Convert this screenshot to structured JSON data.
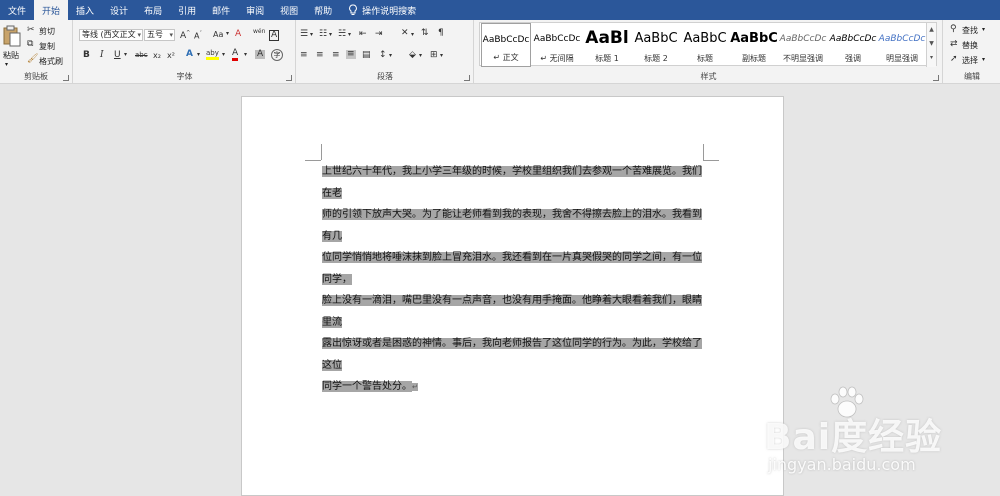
{
  "tabs": [
    "文件",
    "开始",
    "插入",
    "设计",
    "布局",
    "引用",
    "邮件",
    "审阅",
    "视图",
    "帮助",
    "操作说明搜索"
  ],
  "active_tab": "开始",
  "clipboard": {
    "paste": "粘贴",
    "cut": "剪切",
    "copy": "复制",
    "format_painter": "格式刷",
    "group_label": "剪贴板"
  },
  "font": {
    "font_name": "等线 (西文正文",
    "font_size": "五号",
    "group_label": "字体",
    "change_case": "Aa",
    "phonetic": "wén",
    "char_border": "A",
    "bold": "B",
    "italic": "I",
    "underline": "U",
    "strike": "abc",
    "subscript": "x₂",
    "superscript": "x²",
    "highlight": "aby",
    "font_color": "A",
    "char_shading": "A",
    "enclose": "字"
  },
  "paragraph": {
    "group_label": "段落"
  },
  "styles": {
    "group_label": "样式",
    "items": [
      {
        "sample": "AaBbCcDc",
        "name": "↵ 正文"
      },
      {
        "sample": "AaBbCcDc",
        "name": "↵ 无间隔"
      },
      {
        "sample": "AaBl",
        "name": "标题 1"
      },
      {
        "sample": "AaBbC",
        "name": "标题 2"
      },
      {
        "sample": "AaBbC",
        "name": "标题"
      },
      {
        "sample": "AaBbC",
        "name": "副标题"
      },
      {
        "sample": "AaBbCcDc",
        "name": "不明显强调"
      },
      {
        "sample": "AaBbCcDc",
        "name": "强调"
      },
      {
        "sample": "AaBbCcDc",
        "name": "明显强调"
      }
    ]
  },
  "editing": {
    "find": "查找",
    "replace": "替换",
    "select": "选择",
    "group_label": "编辑"
  },
  "document": {
    "lines": [
      "上世纪六十年代，我上小学三年级的时候，学校里组织我们去参观一个苦难展览。我们在老",
      "师的引领下放声大哭。为了能让老师看到我的表现，我舍不得擦去脸上的泪水。我看到有几",
      "位同学悄悄地将唾沫抹到脸上冒充泪水。我还看到在一片真哭假哭的同学之间，有一位同学，",
      "脸上没有一滴泪，嘴巴里没有一点声音，也没有用手掩面。他睁着大眼看着我们，眼睛里流",
      "露出惊讶或者是困惑的神情。事后，我向老师报告了这位同学的行为。为此，学校给了这位",
      "同学一个警告处分。"
    ],
    "paragraph_mark": "↵"
  },
  "watermark": {
    "brand": "Bai度经验",
    "url": "jingyan.baidu.com"
  }
}
